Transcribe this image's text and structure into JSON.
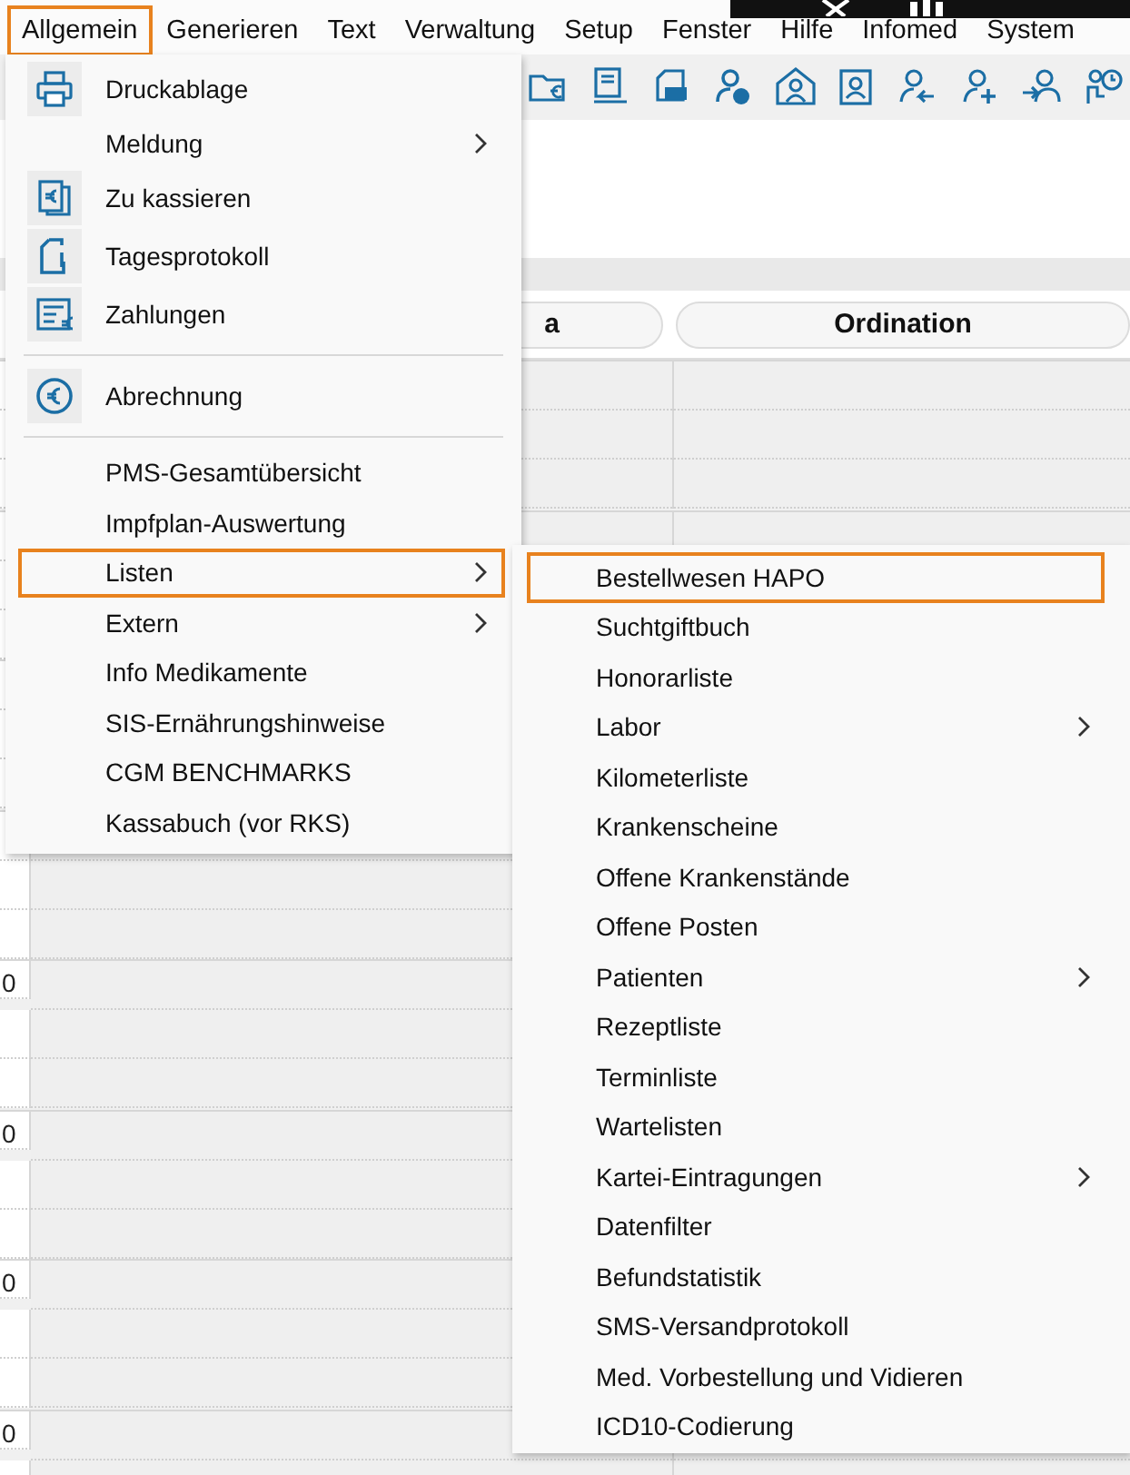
{
  "menu_bar": [
    {
      "label": "Allgemein",
      "selected": true
    },
    {
      "label": "Generieren",
      "selected": false
    },
    {
      "label": "Text",
      "selected": false
    },
    {
      "label": "Verwaltung",
      "selected": false
    },
    {
      "label": "Setup",
      "selected": false
    },
    {
      "label": "Fenster",
      "selected": false
    },
    {
      "label": "Hilfe",
      "selected": false
    },
    {
      "label": "Infomed",
      "selected": false
    },
    {
      "label": "System",
      "selected": false
    }
  ],
  "board": {
    "column_1": "a",
    "column_2": "Ordination",
    "time_labels": [
      "0",
      "0",
      "0",
      "0"
    ]
  },
  "menu": {
    "items": [
      {
        "kind": "icon",
        "label": "Druckablage",
        "submenu": false,
        "selected": false
      },
      {
        "kind": "plain",
        "label": "Meldung",
        "submenu": true,
        "selected": false
      },
      {
        "kind": "icon",
        "label": "Zu kassieren",
        "submenu": false,
        "selected": false
      },
      {
        "kind": "icon",
        "label": "Tagesprotokoll",
        "submenu": false,
        "selected": false
      },
      {
        "kind": "icon",
        "label": "Zahlungen",
        "submenu": false,
        "selected": false
      },
      {
        "kind": "separator"
      },
      {
        "kind": "icon",
        "label": "Abrechnung",
        "submenu": false,
        "selected": false
      },
      {
        "kind": "separator"
      },
      {
        "kind": "plain",
        "label": "PMS-Gesamtübersicht",
        "submenu": false,
        "selected": false
      },
      {
        "kind": "plain",
        "label": "Impfplan-Auswertung",
        "submenu": false,
        "selected": false
      },
      {
        "kind": "plain",
        "label": "Listen",
        "submenu": true,
        "selected": true
      },
      {
        "kind": "plain",
        "label": "Extern",
        "submenu": true,
        "selected": false
      },
      {
        "kind": "plain",
        "label": "Info Medikamente",
        "submenu": false,
        "selected": false
      },
      {
        "kind": "plain",
        "label": "SIS-Ernährungshinweise",
        "submenu": false,
        "selected": false
      },
      {
        "kind": "plain",
        "label": "CGM BENCHMARKS",
        "submenu": false,
        "selected": false
      },
      {
        "kind": "plain",
        "label": "Kassabuch (vor RKS)",
        "submenu": false,
        "selected": false
      }
    ]
  },
  "submenu": {
    "items": [
      {
        "label": "Bestellwesen HAPO",
        "submenu": false,
        "selected": true
      },
      {
        "label": "Suchtgiftbuch",
        "submenu": false,
        "selected": false
      },
      {
        "label": "Honorarliste",
        "submenu": false,
        "selected": false
      },
      {
        "label": "Labor",
        "submenu": true,
        "selected": false
      },
      {
        "label": "Kilometerliste",
        "submenu": false,
        "selected": false
      },
      {
        "label": "Krankenscheine",
        "submenu": false,
        "selected": false
      },
      {
        "label": "Offene Krankenstände",
        "submenu": false,
        "selected": false
      },
      {
        "label": "Offene Posten",
        "submenu": false,
        "selected": false
      },
      {
        "label": "Patienten",
        "submenu": true,
        "selected": false
      },
      {
        "label": "Rezeptliste",
        "submenu": false,
        "selected": false
      },
      {
        "label": "Terminliste",
        "submenu": false,
        "selected": false
      },
      {
        "label": "Wartelisten",
        "submenu": false,
        "selected": false
      },
      {
        "label": "Kartei-Eintragungen",
        "submenu": true,
        "selected": false
      },
      {
        "label": "Datenfilter",
        "submenu": false,
        "selected": false
      },
      {
        "label": "Befundstatistik",
        "submenu": false,
        "selected": false
      },
      {
        "label": "SMS-Versandprotokoll",
        "submenu": false,
        "selected": false
      },
      {
        "label": "Med. Vorbestellung und Vidieren",
        "submenu": false,
        "selected": false
      },
      {
        "label": "ICD10-Codierung",
        "submenu": false,
        "selected": false
      }
    ]
  }
}
